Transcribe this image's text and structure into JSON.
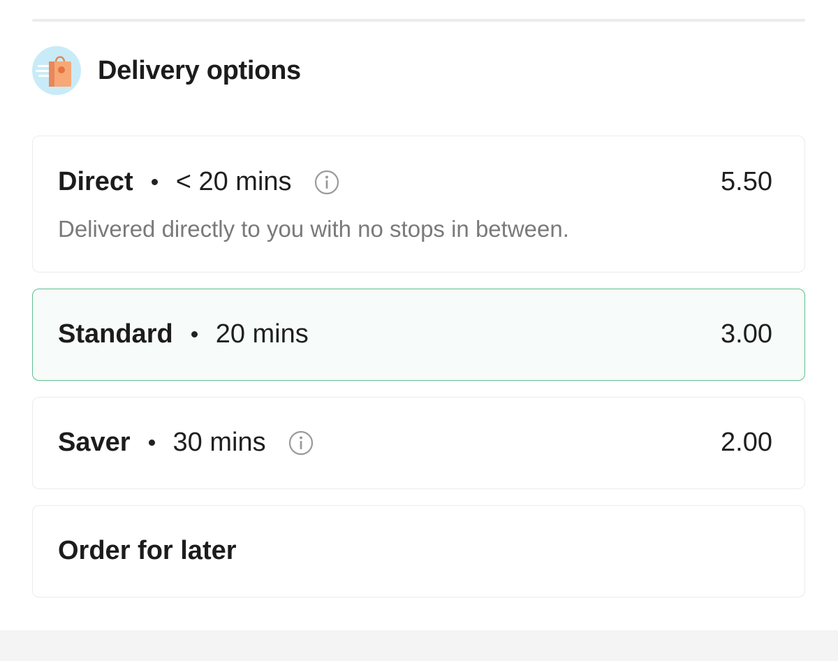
{
  "header": {
    "title": "Delivery options",
    "icon": "shopping-bag-delivery-icon"
  },
  "options": [
    {
      "name": "Direct",
      "time": "< 20 mins",
      "price": "5.50",
      "description": "Delivered directly to you with no stops in between.",
      "has_info": true,
      "selected": false
    },
    {
      "name": "Standard",
      "time": "20 mins",
      "price": "3.00",
      "has_info": false,
      "selected": true
    },
    {
      "name": "Saver",
      "time": "30 mins",
      "price": "2.00",
      "has_info": true,
      "selected": false
    },
    {
      "name": "Order for later",
      "selected": false
    }
  ],
  "colors": {
    "selected_border": "#5fbf8f",
    "selected_background": "#f7fbf9",
    "icon_background": "#c9ebf7",
    "bag_color": "#f6a877"
  }
}
